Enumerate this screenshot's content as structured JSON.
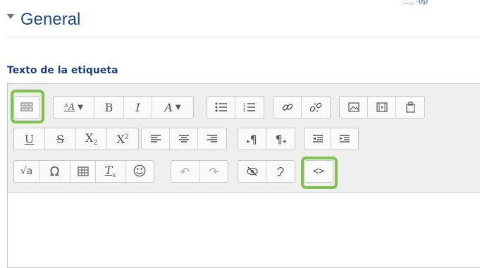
{
  "header": {
    "top_link_text": "…, ·ep"
  },
  "section": {
    "title": "General"
  },
  "field": {
    "label": "Texto de la etiqueta"
  },
  "toolbar": {
    "glyphs": {
      "font_size": "ᴬA",
      "bold": "B",
      "italic": "I",
      "text_color": "A",
      "underline": "U",
      "strike": "S",
      "subscript": "X",
      "subscript_mark": "2",
      "superscript": "X",
      "superscript_mark": "2",
      "ltr": "¶",
      "rtl": "¶",
      "equation": "√a",
      "omega": "Ω",
      "clear_format": "T",
      "clear_mark": "x",
      "emoji": "☺",
      "undo": "↶",
      "redo": "↷",
      "html": "<>"
    },
    "highlighted": [
      "toolbar_toggle",
      "html_view"
    ],
    "highlight_color": "#7ec34b"
  },
  "colors": {
    "title": "#1b4d87",
    "label": "#1b3f86"
  }
}
